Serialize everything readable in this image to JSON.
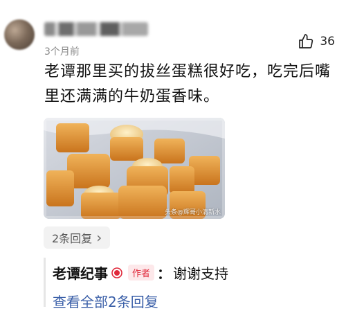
{
  "comment": {
    "time": "3个月前",
    "likes": "36",
    "text_line1": "老谭那里买的拔丝蛋糕很好吃，吃完后嘴",
    "text_line2": "里还满满的牛奶蛋香味。",
    "image_watermark": "头条@辉哥小清新水"
  },
  "replies": {
    "count_label": "2条回复",
    "chevron": "›",
    "first": {
      "author": "老谭纪事",
      "badge": "作者",
      "colon": "：",
      "text": "谢谢支持"
    },
    "view_all": "查看全部2条回复"
  },
  "icons": {
    "like": "thumbs-up-icon",
    "verify": "verified-badge-icon",
    "chevron": "chevron-right-icon"
  },
  "colors": {
    "author_badge": "#e0293b",
    "link": "#3a5fa8"
  }
}
